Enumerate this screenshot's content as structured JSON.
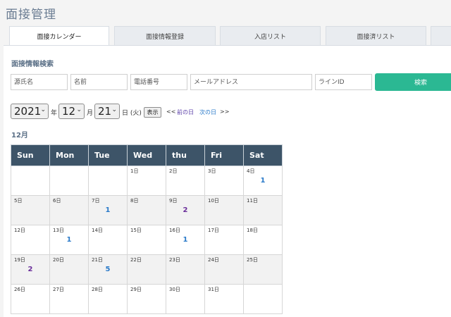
{
  "page_title": "面接管理",
  "tabs": [
    "面接カレンダー",
    "面接情報登録",
    "入店リスト",
    "面接済リスト"
  ],
  "search": {
    "title": "面接情報検索",
    "placeholders": [
      "源氏名",
      "名前",
      "電話番号",
      "メールアドレス",
      "ラインID"
    ],
    "button": "検索"
  },
  "date": {
    "year": "2021",
    "year_unit": "年",
    "month": "12",
    "month_unit": "月",
    "day": "21",
    "day_unit": "日 (火)",
    "show_button": "表示",
    "prev_arrow": "<<",
    "prev_label": "前の日",
    "next_label": "次の日",
    "next_arrow": ">>"
  },
  "calendar": {
    "month_label": "12月",
    "weekdays": [
      "Sun",
      "Mon",
      "Tue",
      "Wed",
      "thu",
      "Fri",
      "Sat"
    ],
    "weeks": [
      [
        {
          "d": "",
          "c": ""
        },
        {
          "d": "",
          "c": ""
        },
        {
          "d": "",
          "c": ""
        },
        {
          "d": "1日",
          "c": ""
        },
        {
          "d": "2日",
          "c": ""
        },
        {
          "d": "3日",
          "c": ""
        },
        {
          "d": "4日",
          "c": "1"
        }
      ],
      [
        {
          "d": "5日",
          "c": ""
        },
        {
          "d": "6日",
          "c": ""
        },
        {
          "d": "7日",
          "c": "1"
        },
        {
          "d": "8日",
          "c": ""
        },
        {
          "d": "9日",
          "c": "2"
        },
        {
          "d": "10日",
          "c": ""
        },
        {
          "d": "11日",
          "c": ""
        }
      ],
      [
        {
          "d": "12日",
          "c": ""
        },
        {
          "d": "13日",
          "c": "1"
        },
        {
          "d": "14日",
          "c": ""
        },
        {
          "d": "15日",
          "c": ""
        },
        {
          "d": "16日",
          "c": "1"
        },
        {
          "d": "17日",
          "c": ""
        },
        {
          "d": "18日",
          "c": ""
        }
      ],
      [
        {
          "d": "19日",
          "c": "2"
        },
        {
          "d": "20日",
          "c": ""
        },
        {
          "d": "21日",
          "c": "5"
        },
        {
          "d": "22日",
          "c": ""
        },
        {
          "d": "23日",
          "c": ""
        },
        {
          "d": "24日",
          "c": ""
        },
        {
          "d": "25日",
          "c": ""
        }
      ],
      [
        {
          "d": "26日",
          "c": ""
        },
        {
          "d": "27日",
          "c": ""
        },
        {
          "d": "28日",
          "c": ""
        },
        {
          "d": "29日",
          "c": ""
        },
        {
          "d": "30日",
          "c": ""
        },
        {
          "d": "31日",
          "c": ""
        },
        {
          "d": "",
          "c": ""
        }
      ]
    ]
  },
  "colors": {
    "header_bg": "#3d5468",
    "accent_green": "#2bb893",
    "count_blue": "#2a7ac9",
    "count_purple": "#6a2e9a"
  }
}
